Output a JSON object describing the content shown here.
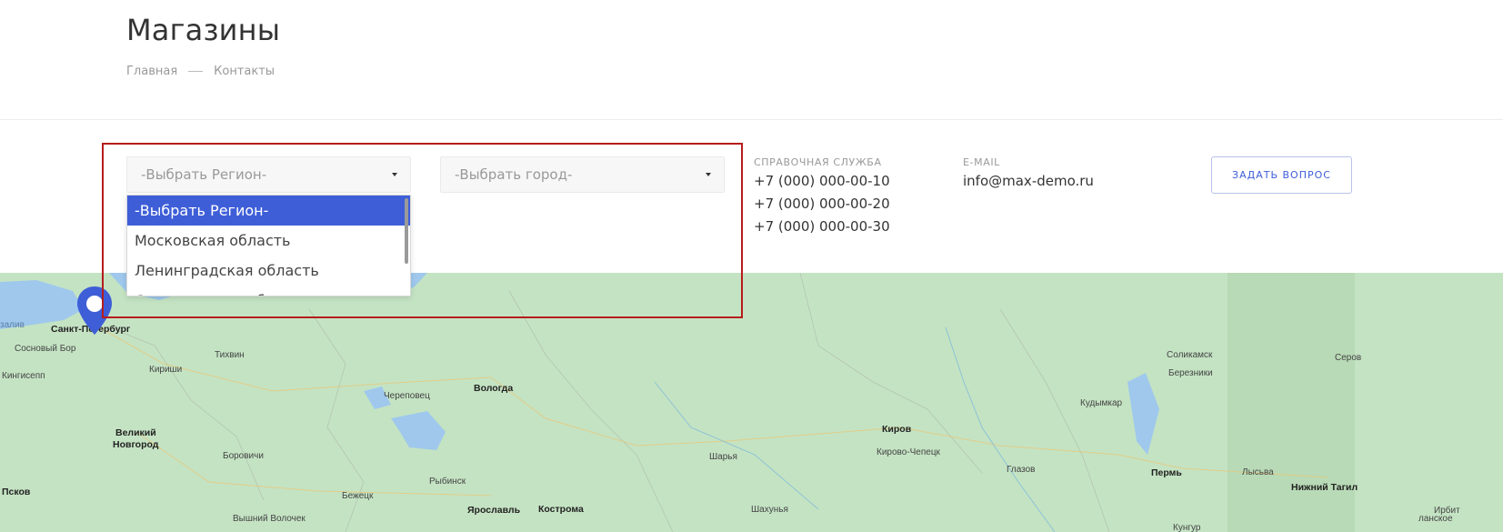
{
  "page": {
    "title": "Магазины",
    "breadcrumb": {
      "home": "Главная",
      "current": "Контакты"
    }
  },
  "filters": {
    "region_placeholder": "-Выбрать Регион-",
    "city_placeholder": "-Выбрать город-",
    "region_options": [
      "-Выбрать Регион-",
      "Московская область",
      "Ленинградская область",
      "Свердловская область"
    ],
    "selected_index": 0
  },
  "contacts": {
    "phone_label": "СПРАВОЧНАЯ СЛУЖБА",
    "phones": [
      "+7 (000) 000-00-10",
      "+7 (000) 000-00-20",
      "+7 (000) 000-00-30"
    ],
    "email_label": "E-MAIL",
    "email": "info@max-demo.ru"
  },
  "actions": {
    "ask_button": "ЗАДАТЬ ВОПРОС"
  },
  "map": {
    "marker_icon": "map-pin-icon",
    "cities": {
      "spb": "Санкт-Петербург",
      "zaliv": "залив",
      "sosnovy_bor": "Сосновый Бор",
      "kingisepp": "Кингисепп",
      "kirishi": "Кириши",
      "tikhvin": "Тихвин",
      "cherepovets": "Череповец",
      "vologda": "Вологда",
      "veliky": "Великий",
      "novgorod": "Новгород",
      "borovichi": "Боровичи",
      "rybinsk": "Рыбинск",
      "pskov": "Псков",
      "bezhetsk": "Бежецк",
      "vyshny_volochek": "Вышний Волочек",
      "yaroslavl": "Ярославль",
      "kostroma": "Кострома",
      "sharya": "Шарья",
      "shakhunya": "Шахунья",
      "kirov": "Киров",
      "kirovo_chepetsk": "Кирово-Чепецк",
      "glazov": "Глазов",
      "kudymkar": "Кудымкар",
      "solikamsk": "Соликамск",
      "berezniki": "Березники",
      "serov": "Серов",
      "perm": "Пермь",
      "lysva": "Лысьва",
      "nizhny_tagil": "Нижний Тагил",
      "irbit": "Ирбит",
      "kungur": "Кунгур",
      "nlane": "ланское"
    },
    "colors": {
      "land": "#c4e3c3",
      "water": "#9fc8ec",
      "accent": "#3e5ed8"
    }
  }
}
